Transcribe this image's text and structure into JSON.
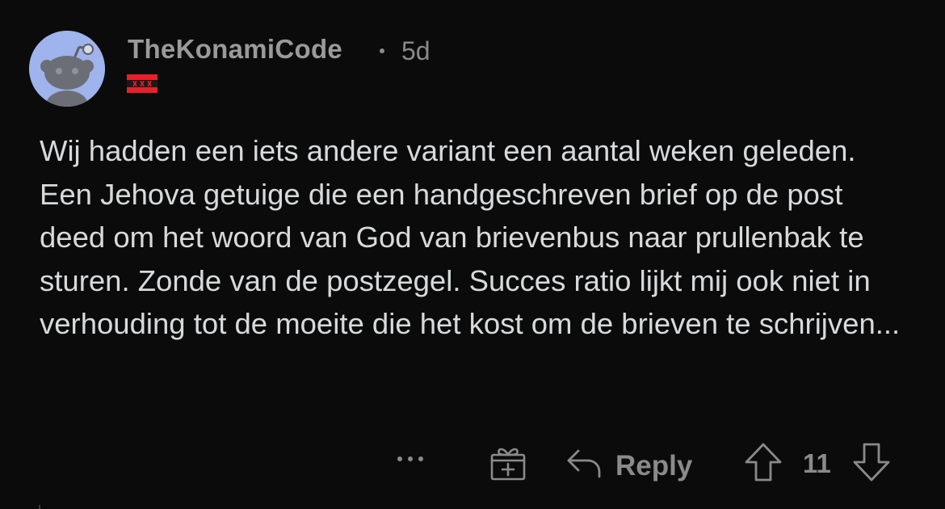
{
  "comment": {
    "author": "TheKonamiCode",
    "separator": "•",
    "age": "5d",
    "flair_icon": "amsterdam-flag-icon",
    "avatar_icon": "reddit-snoo-avatar",
    "body": "Wij hadden een iets andere variant een aantal weken geleden. Een Jehova getuige die een handgeschreven brief op de post deed om het woord van God van brievenbus naar prullenbak te sturen. Zonde van de postzegel. Succes ratio lijkt mij ook niet in verhouding tot de moeite die het kost om de brieven te schrijven..."
  },
  "actions": {
    "more_icon": "more-dots-icon",
    "award_icon": "gift-award-icon",
    "reply_label": "Reply",
    "reply_icon": "reply-arrow-icon",
    "upvote_icon": "upvote-arrow-icon",
    "score": "11",
    "downvote_icon": "downvote-arrow-icon"
  },
  "colors": {
    "background": "#0b0b0b",
    "text": "#d7dadc",
    "muted": "#8a8a8a",
    "avatar_bg": "#9fb3ec",
    "flair_red": "#e8202a"
  }
}
